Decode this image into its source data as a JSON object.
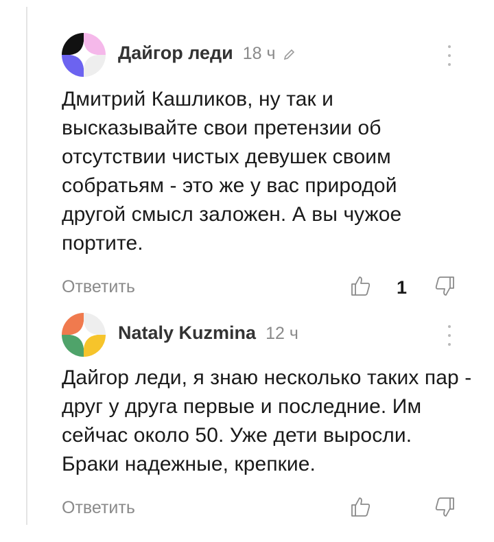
{
  "comments": [
    {
      "author": "Дайгор леди",
      "time": "18 ч",
      "edited": true,
      "avatar_colors": [
        "#111111",
        "#f5b8ea",
        "#6c63f0",
        "#eeeeee"
      ],
      "text": "Дмитрий Кашликов, ну так и высказывайте свои претензии об отсутствии чистых девушек своим собратьям - это же у вас природой другой смысл заложен. А вы чужое портите.",
      "reply_label": "Ответить",
      "likes": "1"
    },
    {
      "author": "Nataly Kuzmina",
      "time": "12 ч",
      "edited": false,
      "avatar_colors": [
        "#f07a4e",
        "#eeeeee",
        "#4fa36a",
        "#f6c42b"
      ],
      "text": "Дайгор леди, я знаю несколько таких пар - друг у друга первые и последние. Им сейчас около 50. Уже дети выросли. Браки надежные, крепкие.",
      "reply_label": "Ответить",
      "likes": ""
    }
  ],
  "icons": {
    "like": "thumbs-up-icon",
    "dislike": "thumbs-down-icon",
    "more": "more-vertical-icon",
    "edit": "pencil-icon"
  }
}
